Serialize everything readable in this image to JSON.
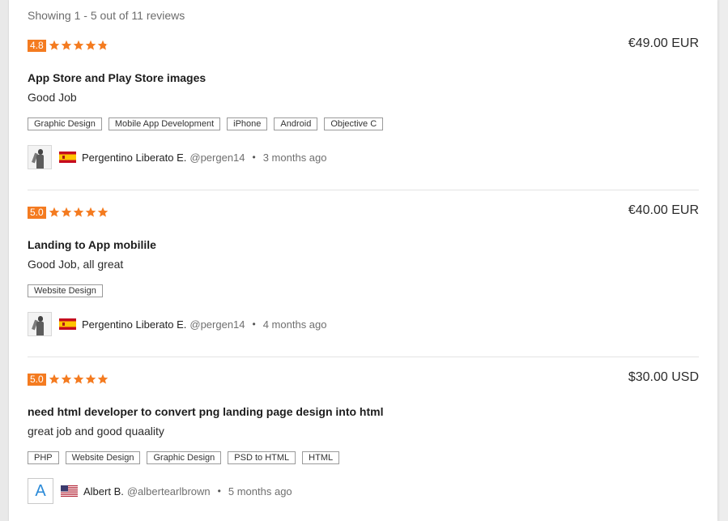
{
  "showing_text": "Showing 1 - 5 out of 11 reviews",
  "colors": {
    "accent": "#f47b20",
    "tag_border": "#9a9a9a",
    "avatar_letter": "#2a8ad8"
  },
  "reviews": [
    {
      "rating": "4.8",
      "stars": 4.8,
      "price": "€49.00 EUR",
      "title": "App Store and Play Store images",
      "comment": "Good Job",
      "tags": [
        "Graphic Design",
        "Mobile App Development",
        "iPhone",
        "Android",
        "Objective C"
      ],
      "author": {
        "name": "Pergentino Liberato E.",
        "handle": "@pergen14",
        "flag": "spain-flag-icon",
        "time": "3 months ago"
      }
    },
    {
      "rating": "5.0",
      "stars": 5,
      "price": "€40.00 EUR",
      "title": "Landing to App mobilile",
      "comment": "Good Job, all great",
      "tags": [
        "Website Design"
      ],
      "author": {
        "name": "Pergentino Liberato E.",
        "handle": "@pergen14",
        "flag": "spain-flag-icon",
        "time": "4 months ago"
      }
    },
    {
      "rating": "5.0",
      "stars": 5,
      "price": "$30.00 USD",
      "title": "need html developer to convert png landing page design into html",
      "comment": "great job and good quaality",
      "tags": [
        "PHP",
        "Website Design",
        "Graphic Design",
        "PSD to HTML",
        "HTML"
      ],
      "author": {
        "name": "Albert B.",
        "handle": "@albertearlbrown",
        "avatar_letter": "A",
        "flag": "usa-flag-icon",
        "time": "5 months ago"
      }
    }
  ]
}
